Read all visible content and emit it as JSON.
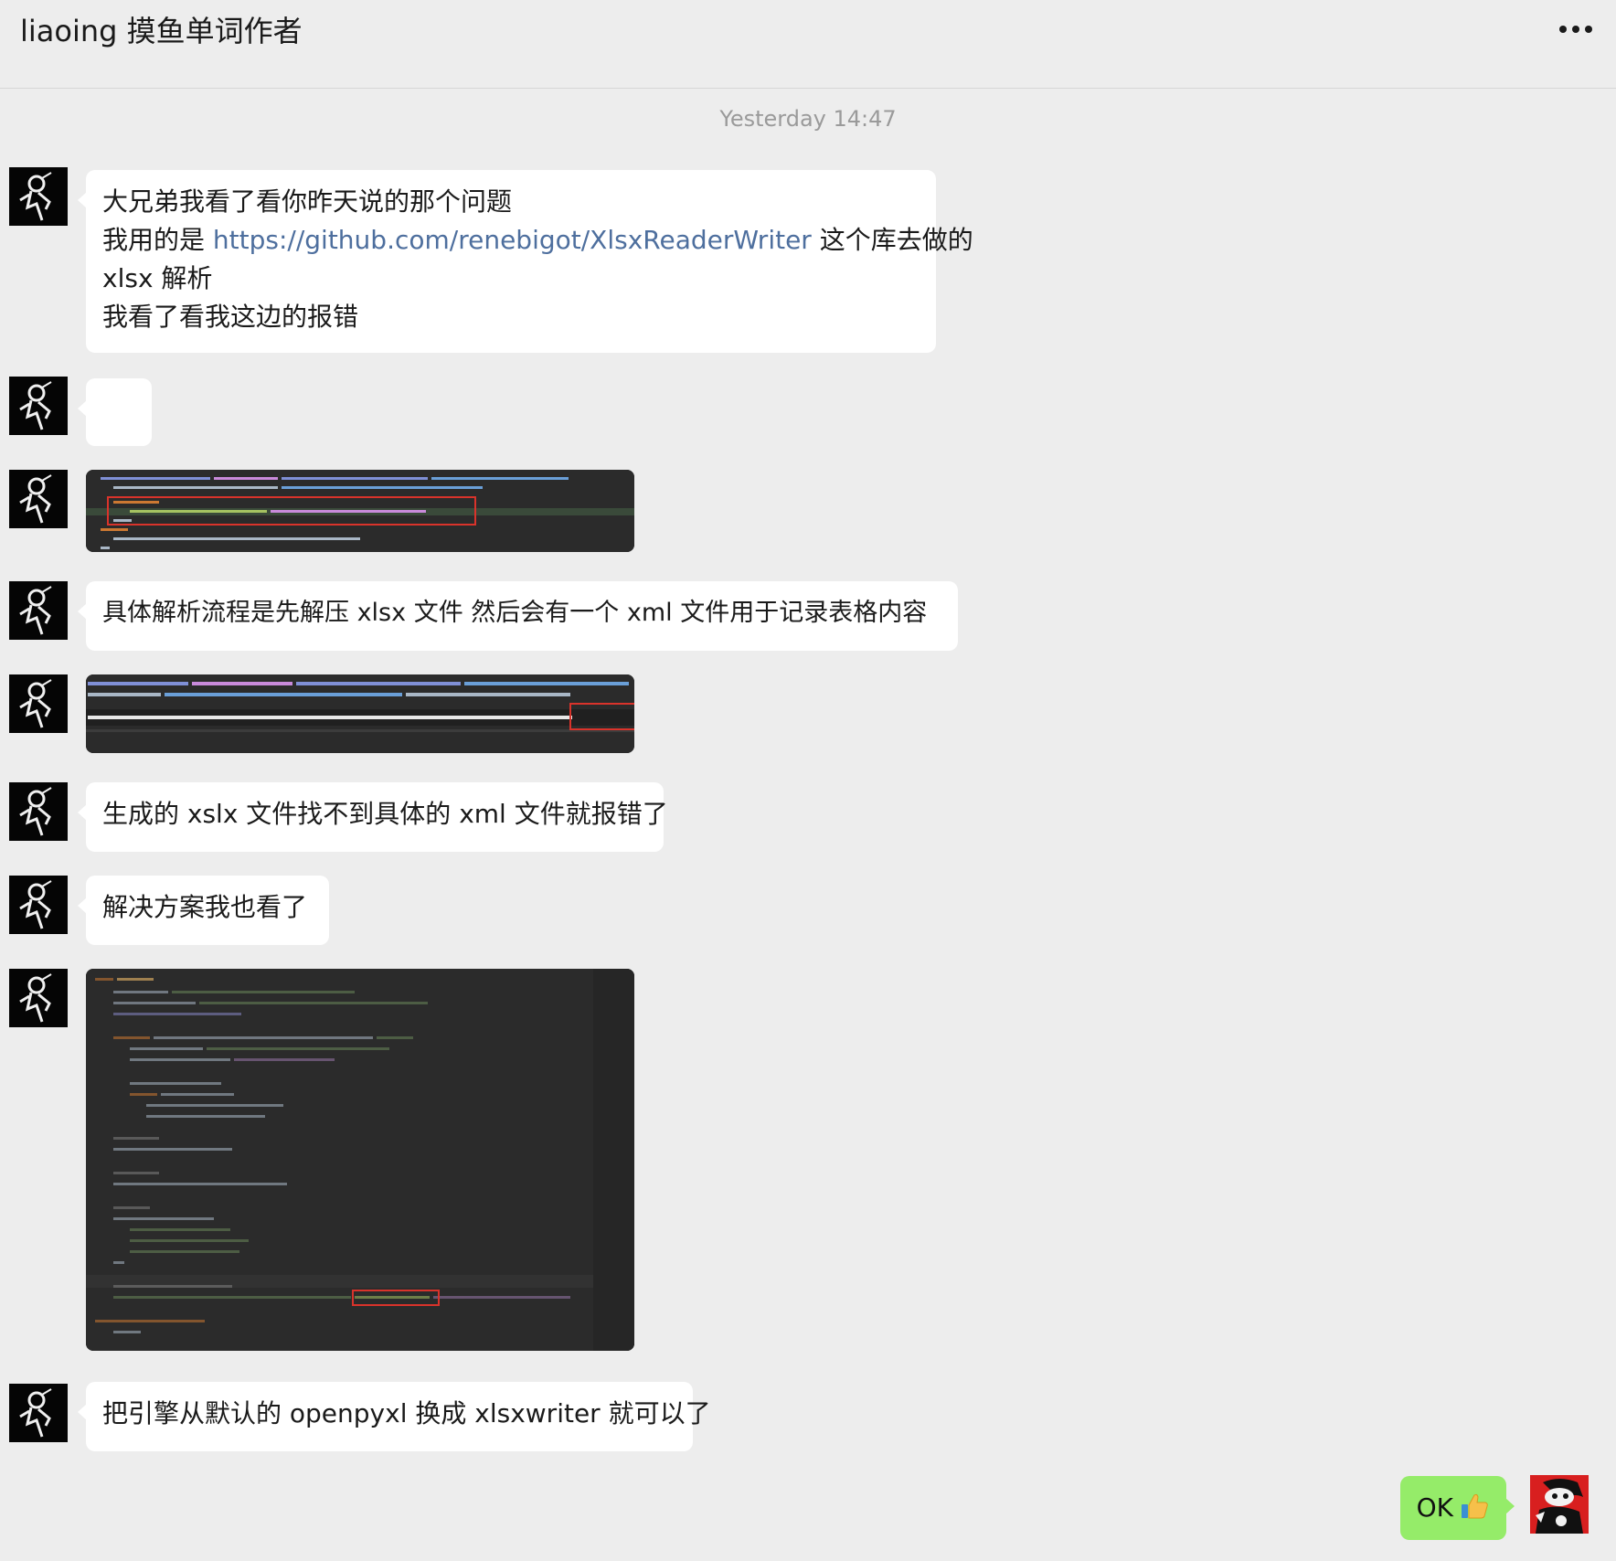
{
  "header": {
    "title": "liaoing 摸鱼单词作者",
    "more_icon": "more-dots-icon"
  },
  "timestamp": "Yesterday 14:47",
  "messages": {
    "m1": {
      "line1": "大兄弟我看了看你昨天说的那个问题",
      "line2_prefix": "我用的是 ",
      "line2_link": "https://github.com/renebigot/XlsxReaderWriter",
      "line2_suffix": " 这个库去做的",
      "line3": " xlsx 解析",
      "line4": "我看了看我这边的报错"
    },
    "m4": "具体解析流程是先解压 xlsx 文件  然后会有一个 xml 文件用于记录表格内容",
    "m6": "生成的 xslx 文件找不到具体的 xml 文件就报错了",
    "m7": "解决方案我也看了",
    "m9": "把引擎从默认的 openpyxl 换成 xlsxwriter 就可以了",
    "my_reply": "OK"
  },
  "colors": {
    "background": "#ededed",
    "bubble_in": "#ffffff",
    "bubble_out": "#95ec69",
    "link": "#4e6f9e",
    "code_bg": "#2b2b2b",
    "highlight_box": "#d9332b"
  },
  "icons": {
    "contact_avatar": "astronaut-avatar-icon",
    "my_avatar": "cartoon-avatar-icon",
    "reply_emoji": "thumbs-up-icon"
  }
}
